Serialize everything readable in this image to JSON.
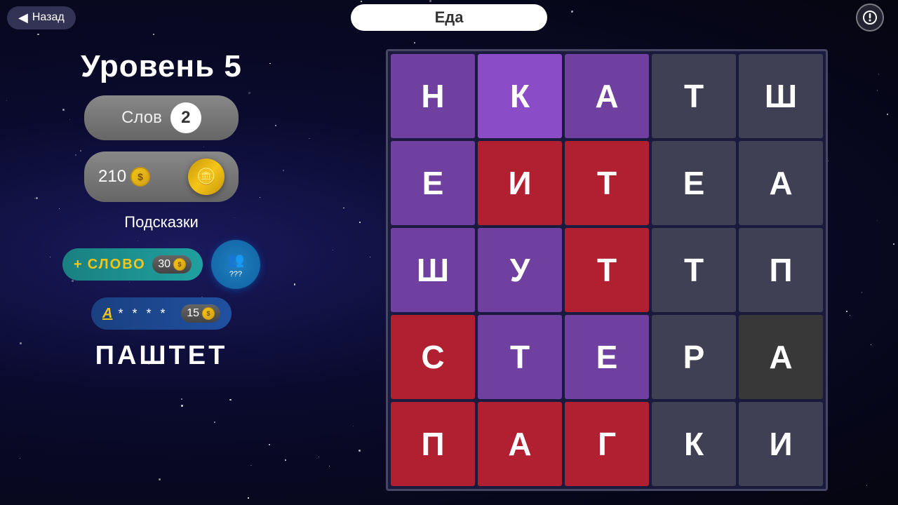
{
  "topbar": {
    "back_label": "Назад",
    "topic_label": "Еда",
    "hint_icon": "◈"
  },
  "left": {
    "level_label": "Уровень 5",
    "words_label": "Слов",
    "words_count": "2",
    "coins_amount": "210",
    "coin_symbol": "$",
    "add_coin_icon": "🪙",
    "hints_title": "Подсказки",
    "hint1_plus": "+",
    "hint1_text": "СЛОВО",
    "hint1_cost": "30",
    "hint2_letter": "А",
    "hint2_stars": "* * * *",
    "hint2_cost": "15",
    "friends_label": "???",
    "current_word": "ПАШТЕТ"
  },
  "grid": {
    "cells": [
      {
        "letter": "Н",
        "style": "purple"
      },
      {
        "letter": "К",
        "style": "purple-light"
      },
      {
        "letter": "А",
        "style": "purple"
      },
      {
        "letter": "Т",
        "style": "gray-dark"
      },
      {
        "letter": "Ш",
        "style": "gray-dark"
      },
      {
        "letter": "Е",
        "style": "purple"
      },
      {
        "letter": "И",
        "style": "red"
      },
      {
        "letter": "Т",
        "style": "red"
      },
      {
        "letter": "Е",
        "style": "gray-dark"
      },
      {
        "letter": "А",
        "style": "gray-dark"
      },
      {
        "letter": "Ш",
        "style": "purple"
      },
      {
        "letter": "У",
        "style": "purple"
      },
      {
        "letter": "Т",
        "style": "red"
      },
      {
        "letter": "Т",
        "style": "gray-dark"
      },
      {
        "letter": "П",
        "style": "gray-dark"
      },
      {
        "letter": "С",
        "style": "red"
      },
      {
        "letter": "Т",
        "style": "purple"
      },
      {
        "letter": "Е",
        "style": "purple"
      },
      {
        "letter": "Р",
        "style": "gray-dark"
      },
      {
        "letter": "А",
        "style": "dark-gray"
      },
      {
        "letter": "П",
        "style": "red"
      },
      {
        "letter": "А",
        "style": "red"
      },
      {
        "letter": "Г",
        "style": "red"
      },
      {
        "letter": "К",
        "style": "gray-dark"
      },
      {
        "letter": "И",
        "style": "gray-dark"
      }
    ]
  }
}
